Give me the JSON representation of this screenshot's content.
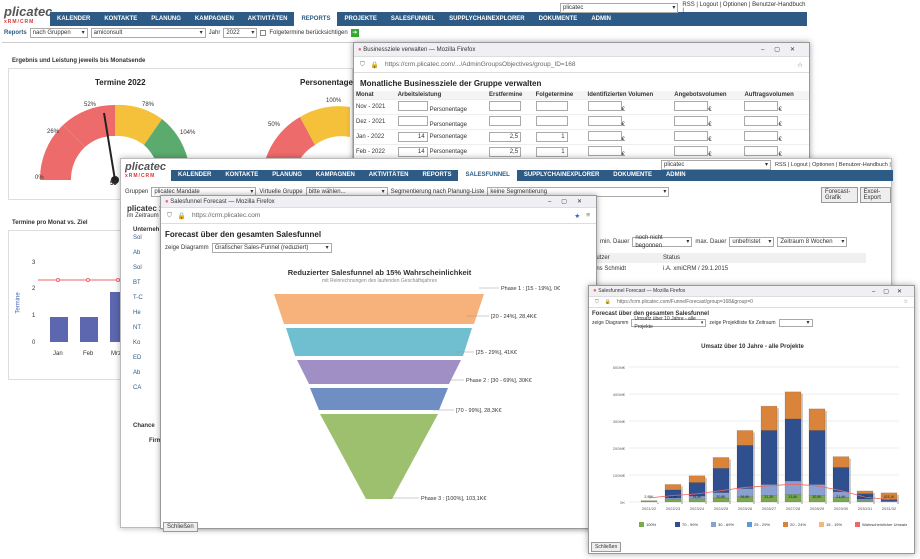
{
  "main": {
    "logo": "plicatec",
    "logo_sub": "xRM/CRM",
    "nav": [
      "KALENDER",
      "KONTAKTE",
      "PLANUNG",
      "KAMPAGNEN",
      "AKTIVITÄTEN",
      "REPORTS",
      "PROJEKTE",
      "SALESFUNNEL",
      "SUPPLYCHAINEXPLORER",
      "DOKUMENTE",
      "ADMIN"
    ],
    "active": "REPORTS",
    "user_select": "plicatec",
    "user_links": "RSS | Logout | Optionen | Benutzer-Handbuch |",
    "reports_label": "Reports",
    "group_sel": "nach Gruppen",
    "client_sel": "amiconsult",
    "year_label": "Jahr",
    "year_sel": "2022",
    "followups": "Folgetermine berücksichtigen",
    "section_title": "Ergebnis und Leistung jeweils bis Monatsende",
    "gauge1_title": "Termine 2022",
    "gauge2_title": "Personentage 2",
    "g_labels": [
      "0%",
      "26%",
      "52%",
      "78%",
      "104%"
    ],
    "g1_value": "53",
    "g2_labels": [
      "50%",
      "100%"
    ],
    "monthly_title": "Termine pro Monat vs. Ziel",
    "yticks": [
      "3",
      "2",
      "1",
      "0"
    ],
    "ylabel": "Termine",
    "months": [
      "Jan",
      "Feb",
      "Mrz"
    ]
  },
  "biz": {
    "title": "Businessziele verwalten — Mozilla Firefox",
    "url": "https://crm.plicatec.com/.../AdminGroupsObjectives/group_ID=168",
    "heading": "Monatliche Businessziele der Gruppe verwalten",
    "cols": [
      "Monat",
      "Arbeitsleistung",
      "Erstfermine",
      "Folgetermine",
      "Identifizierten Volumen",
      "Angebotsvolumen",
      "Auftragsvolumen"
    ],
    "rows": [
      {
        "m": "Nov - 2021",
        "unit": "Personentage",
        "a": "",
        "b": "",
        "c": ""
      },
      {
        "m": "Dez - 2021",
        "unit": "Personentage",
        "a": "",
        "b": "",
        "c": ""
      },
      {
        "m": "Jan - 2022",
        "unit": "Personentage",
        "a": "14",
        "b": "2,5",
        "c": "1"
      },
      {
        "m": "Feb - 2022",
        "unit": "Personentage",
        "a": "14",
        "b": "2,5",
        "c": "1"
      }
    ],
    "euro": "€"
  },
  "sf": {
    "logo": "plicatec",
    "nav": [
      "KALENDER",
      "KONTAKTE",
      "PLANUNG",
      "KAMPAGNEN",
      "AKTIVITÄTEN",
      "REPORTS",
      "SALESFUNNEL",
      "SUPPLYCHAINEXPLORER",
      "DOKUMENTE",
      "ADMIN"
    ],
    "active": "SALESFUNNEL",
    "user_select": "plicatec",
    "user_links": "RSS | Logout | Optionen | Benutzer-Handbuch |",
    "gruppe_label": "Gruppen",
    "gruppe_sel": "plicatec Mandate",
    "vgruppe_label": "Virtuelle Gruppe",
    "vgruppe_sel": "bitte wählen...",
    "seg_label": "Segmentierung nach Planung-Liste",
    "seg_sel": "keine Segmentierung",
    "btn_fc": "Forecast-Grafik",
    "btn_xl": "Excel-Export",
    "subtitle": "plicatec x",
    "sub2": "im Zeitraum vo",
    "unternehmen": "Unterneh",
    "min_dauer": "min. Dauer",
    "nb_sel": "noch nicht begonnen",
    "max_dauer": "max. Dauer",
    "unbef": "unbefristet",
    "zeitraum": "Zeitraum 8 Wochen",
    "col_nutzer": "nutzer",
    "col_status": "Status",
    "row1_n": "ens Schmidt",
    "row1_s": "i.A. xmiCRM / 29.1.2015",
    "chancen": "Chance",
    "firm": "Firm",
    "list_left": [
      "Sol",
      "Ab",
      "Sol",
      "BT",
      "T-C",
      "He",
      "NT",
      "Ko",
      "ED",
      "Ab",
      "CA"
    ]
  },
  "fc1": {
    "title": "Salesfunnel Forecast — Mozilla Firefox",
    "url": "https://crm.plicatec.com",
    "heading": "Forecast über den gesamten Salesfunnel",
    "diag_label": "zeige Diagramm",
    "diag_sel": "Grafischer Sales-Funnel (reduziert)",
    "chart_title": "Reduzierter Salesfunnel ab 15% Wahrscheinlichkeit",
    "chart_sub": "mit Reinrechnungen des laufenden Geschäftsjahres",
    "close_btn": "Schließen"
  },
  "fc2": {
    "title": "Salesfunnel Forecast — Mozilla Firefox",
    "url": "https://crm.plicatec.com/FunnelForecast/group=168&group=0",
    "heading": "Forecast über den gesamten Salesfunnel",
    "diag_label": "zeige Diagramm",
    "diag_sel": "Umsatz über 10 Jahre - alle Projekte",
    "period_label": "zeige Projektliste für Zeitraum",
    "chart_title": "Umsatz über 10 Jahre - alle Projekte",
    "close_btn": "Schließen"
  },
  "chart_data": [
    {
      "type": "bar",
      "title": "Reduzierter Salesfunnel ab 15% Wahrscheinlichkeit",
      "subtitle": "mit Reinrechnungen des laufenden Geschäftsjahres",
      "categories": [
        "Phase 1 : [15 - 19%], 0€",
        "[20 - 24%], 28,4K€",
        "[25 - 29%], 41K€",
        "Phase 2 : [30 - 69%], 30K€",
        "[70 - 99%], 28,3K€",
        "Phase 3 : [100%], 103,1K€"
      ],
      "values": [
        0,
        28.4,
        41,
        30,
        28.3,
        103.1
      ],
      "colors": [
        "#f6b27a",
        "#6fbfd0",
        "#a08fc4",
        "#6f8fc4",
        "#9cc06e"
      ]
    },
    {
      "type": "bar",
      "title": "Umsatz über 10 Jahre - alle Projekte",
      "categories": [
        "2021/22",
        "2022/23",
        "2023/24",
        "2024/25",
        "2025/26",
        "2026/27",
        "2027/28",
        "2028/29",
        "2029/30",
        "2030/31",
        "2031/32"
      ],
      "series": [
        {
          "name": "100%",
          "values": [
            5,
            10,
            12,
            15,
            20,
            25,
            28,
            25,
            18,
            6,
            2
          ]
        },
        {
          "name": "70 - 99%",
          "values": [
            0,
            30,
            50,
            90,
            160,
            200,
            230,
            200,
            90,
            20,
            5
          ]
        },
        {
          "name": "30 - 69%",
          "values": [
            0,
            5,
            10,
            20,
            30,
            40,
            50,
            40,
            20,
            5,
            2
          ]
        },
        {
          "name": "25 - 29%",
          "values": [
            0,
            0,
            0,
            0,
            0,
            0,
            0,
            0,
            0,
            0,
            0
          ]
        },
        {
          "name": "20 - 24%",
          "values": [
            0,
            20,
            25,
            40,
            55,
            90,
            100,
            80,
            40,
            10,
            25
          ]
        },
        {
          "name": "15 - 19%",
          "values": [
            0,
            0,
            0,
            0,
            0,
            0,
            0,
            0,
            0,
            0,
            0
          ]
        },
        {
          "name": "Wahrscheinlicher Umsatz",
          "values": [
            5,
            8,
            10,
            14,
            18,
            20,
            22,
            20,
            14,
            6,
            3
          ]
        }
      ],
      "yticks": [
        "0K",
        "100M€",
        "200M€",
        "300M€",
        "400M€",
        "500M€"
      ],
      "labels": [
        "2,95K",
        "11,5K",
        "14,5K",
        "20,8K",
        "26,5K",
        "31,3K",
        "23,8K",
        "30,5K",
        "21,4K",
        "4,5K",
        "103,1K"
      ]
    }
  ]
}
